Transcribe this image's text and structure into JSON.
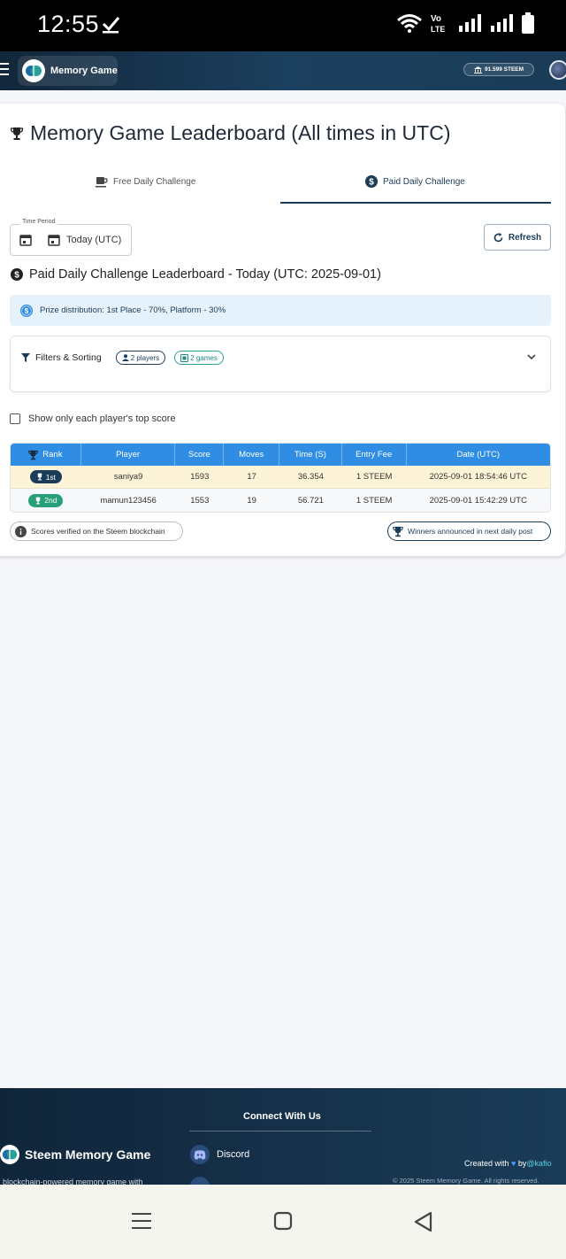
{
  "status_bar": {
    "time": "12:55"
  },
  "app": {
    "brand": "Memory Game",
    "wallet": "91.599 STEEM"
  },
  "page": {
    "title": "Memory Game Leaderboard (All times in UTC)"
  },
  "tabs": [
    {
      "label": "Free Daily Challenge",
      "active": false
    },
    {
      "label": "Paid Daily Challenge",
      "active": true
    }
  ],
  "filter": {
    "time_period_label": "Time Period",
    "time_period_value": "Today (UTC)",
    "refresh_label": "Refresh"
  },
  "leaderboard": {
    "subtitle": "Paid Daily Challenge Leaderboard - Today (UTC: 2025-09-01)",
    "prize_text": "Prize distribution: 1st Place - 70%, Platform - 30%",
    "filters_label": "Filters & Sorting",
    "players_chip": "2 players",
    "games_chip": "2 games",
    "top_score_label": "Show only each player's top score"
  },
  "table": {
    "headers": [
      "Rank",
      "Player",
      "Score",
      "Moves",
      "Time (S)",
      "Entry Fee",
      "Date (UTC)"
    ],
    "rows": [
      {
        "rank": "1st",
        "player": "saniya9",
        "score": "1593",
        "moves": "17",
        "time": "36.354",
        "fee": "1 STEEM",
        "date": "2025-09-01 18:54:46 UTC"
      },
      {
        "rank": "2nd",
        "player": "mamun123456",
        "score": "1553",
        "moves": "19",
        "time": "56.721",
        "fee": "1 STEEM",
        "date": "2025-09-01 15:42:29 UTC"
      }
    ]
  },
  "notes": {
    "verified": "Scores verified on the Steem blockchain",
    "winners": "Winners announced in next daily post"
  },
  "footer": {
    "connect": "Connect With Us",
    "discord": "Discord",
    "brand": "Steem Memory Game",
    "description": "blockchain-powered memory game with",
    "created_prefix": "Created with",
    "created_by": "by",
    "created_handle": "@kafio",
    "copyright": "© 2025 Steem Memory Game. All rights reserved."
  },
  "colors": {
    "primary": "#1a3c58",
    "table_header": "#2f8de4",
    "gold_row": "#fdf4d7",
    "silver_badge": "#27a07a"
  }
}
